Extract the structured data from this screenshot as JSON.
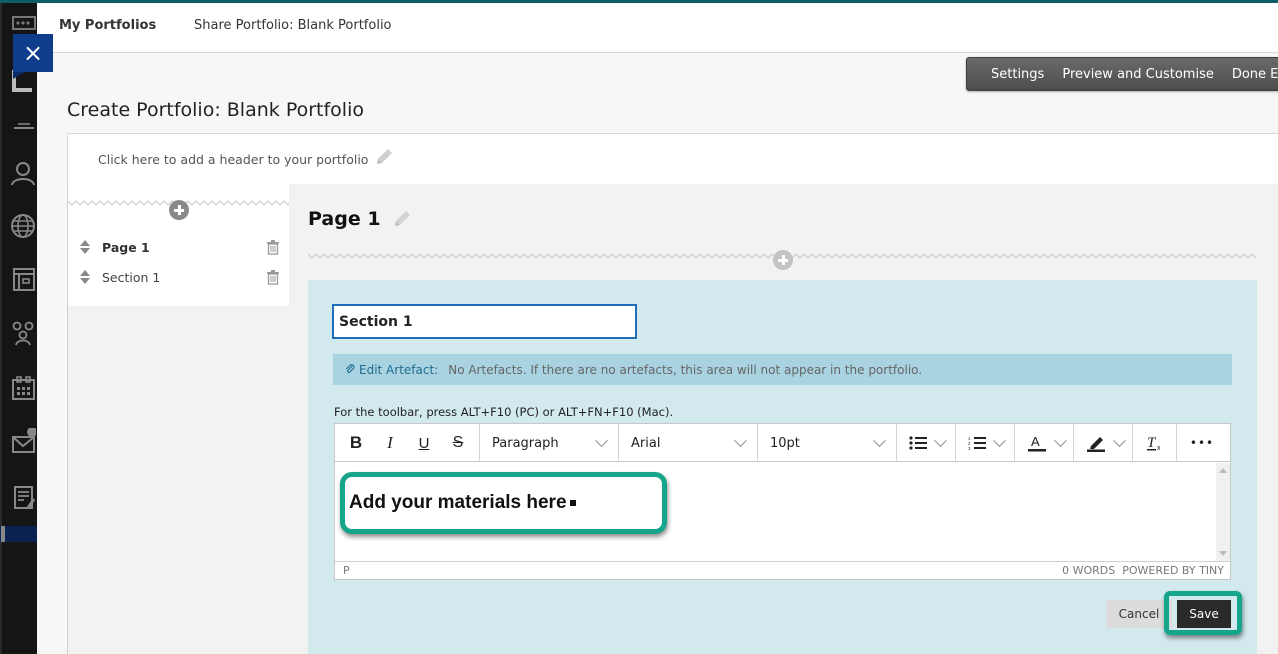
{
  "nav": {
    "breadcrumb_main": "My Portfolios",
    "breadcrumb_sub": "Share Portfolio: Blank Portfolio",
    "close_icon": "×"
  },
  "rail_icons": [
    "apps-icon",
    "logo-icon",
    "institution-icon",
    "profile-icon",
    "globe-icon",
    "courses-icon",
    "groups-icon",
    "calendar-icon",
    "messages-icon",
    "grades-icon"
  ],
  "actions": {
    "settings": "Settings",
    "preview": "Preview and Customise",
    "done": "Done Editing"
  },
  "page_title": "Create Portfolio: Blank Portfolio",
  "header_prompt": "Click here to add a header to your portfolio",
  "outline": {
    "items": [
      {
        "label": "Page 1",
        "type": "page"
      },
      {
        "label": "Section 1",
        "type": "section"
      }
    ]
  },
  "main": {
    "page_heading": "Page 1",
    "section_name_value": "Section 1",
    "artefact_link": "Edit Artefact:",
    "artefact_message": "No Artefacts. If there are no artefacts, this area will not appear in the portfolio.",
    "toolbar_hint": "For the toolbar, press ALT+F10 (PC) or ALT+FN+F10 (Mac).",
    "editor": {
      "bold": "B",
      "italic": "I",
      "underline": "U",
      "strike": "S",
      "block_format": "Paragraph",
      "font_family": "Arial",
      "font_size": "10pt",
      "more": "•••",
      "path": "P",
      "word_count": "0 WORDS",
      "powered_by": "POWERED BY TINY",
      "callout_text": "Add your materials here"
    },
    "cancel_label": "Cancel",
    "save_label": "Save"
  },
  "colors": {
    "accent_teal": "#15a58b",
    "section_bg": "#d2e9ee",
    "artefact_bar": "#a9d3e0",
    "close_btn": "#0e3d8c",
    "focus_border": "#1f6fb8"
  }
}
